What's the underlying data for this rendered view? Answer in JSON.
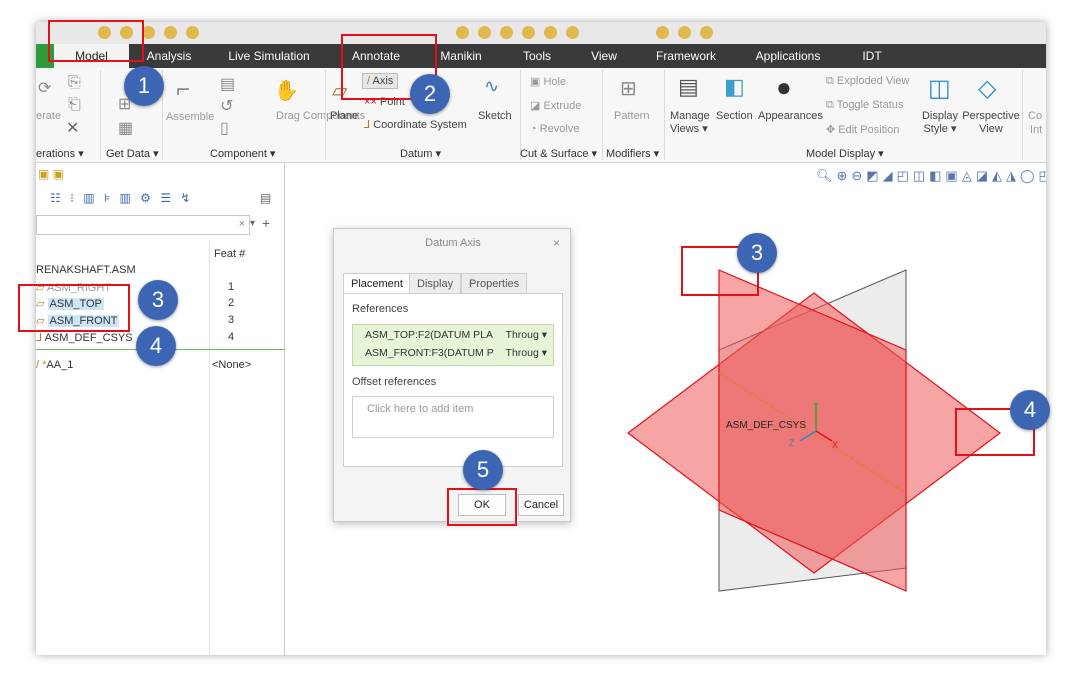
{
  "tabs": [
    "Model",
    "Analysis",
    "Live Simulation",
    "Annotate",
    "Manikin",
    "Tools",
    "View",
    "Framework",
    "Applications",
    "IDT"
  ],
  "ribbon": {
    "operations_group": "erations ▾",
    "get_data_group": "Get Data ▾",
    "component_group": "Component ▾",
    "datum_group": "Datum ▾",
    "cut_surface_group": "Cut & Surface ▾",
    "modifiers_group": "Modifiers ▾",
    "model_display_group": "Model Display ▾",
    "generate_label": "erate",
    "assemble_label": "Assemble",
    "drag_components_label": "Drag Components",
    "plane_label": "Plane",
    "axis_label": "Axis",
    "point_label": "Point",
    "csys_label": "Coordinate System",
    "sketch_label": "Sketch",
    "hole_label": "Hole",
    "extrude_label": "Extrude",
    "revolve_label": "Revolve",
    "pattern_label": "Pattern",
    "manage_views_label": "Manage Views ▾",
    "section_label": "Section",
    "appearances_label": "Appearances",
    "exploded_view_label": "Exploded View",
    "toggle_status_label": "Toggle Status",
    "edit_position_label": "Edit Position",
    "display_style_label": "Display Style ▾",
    "perspective_view_label": "Perspective View",
    "cut_label": "Co",
    "cut2_label": "Int"
  },
  "tree": {
    "feat_header": "Feat #",
    "root": "RENAKSHAFT.ASM",
    "rows": [
      {
        "name": "ASM_RIGHT",
        "feat": "1"
      },
      {
        "name": "ASM_TOP",
        "feat": "2"
      },
      {
        "name": "ASM_FRONT",
        "feat": "3"
      },
      {
        "name": "ASM_DEF_CSYS",
        "feat": "4"
      }
    ],
    "new_feature": "AA_1",
    "new_feature_feat": "<None>"
  },
  "dialog": {
    "title": "Datum Axis",
    "close": "×",
    "tabs": [
      "Placement",
      "Display",
      "Properties"
    ],
    "references_label": "References",
    "references": [
      {
        "ref": "ASM_TOP:F2(DATUM PLA",
        "constraint": "Throug ▾"
      },
      {
        "ref": "ASM_FRONT:F3(DATUM P",
        "constraint": "Throug ▾"
      }
    ],
    "offset_label": "Offset references",
    "offset_placeholder": "Click here to add item",
    "ok": "OK",
    "cancel": "Cancel"
  },
  "graphics": {
    "csys_label": "ASM_DEF_CSYS",
    "y_axis": "Y",
    "z_axis": "Z",
    "x_axis": "X"
  },
  "badges": [
    "1",
    "2",
    "3",
    "4",
    "5",
    "3",
    "4"
  ],
  "colors": {
    "tab_bar": "#3a3a3a",
    "active_tab": "#f3f3f3",
    "highlight_red": "#e3101a",
    "badge_blue": "#3c66b4",
    "plane_red": "#ee5a5a",
    "plane_gray": "#d9d9d9",
    "selection": "#cde6f7",
    "reference_green": "#e7f4d8"
  }
}
